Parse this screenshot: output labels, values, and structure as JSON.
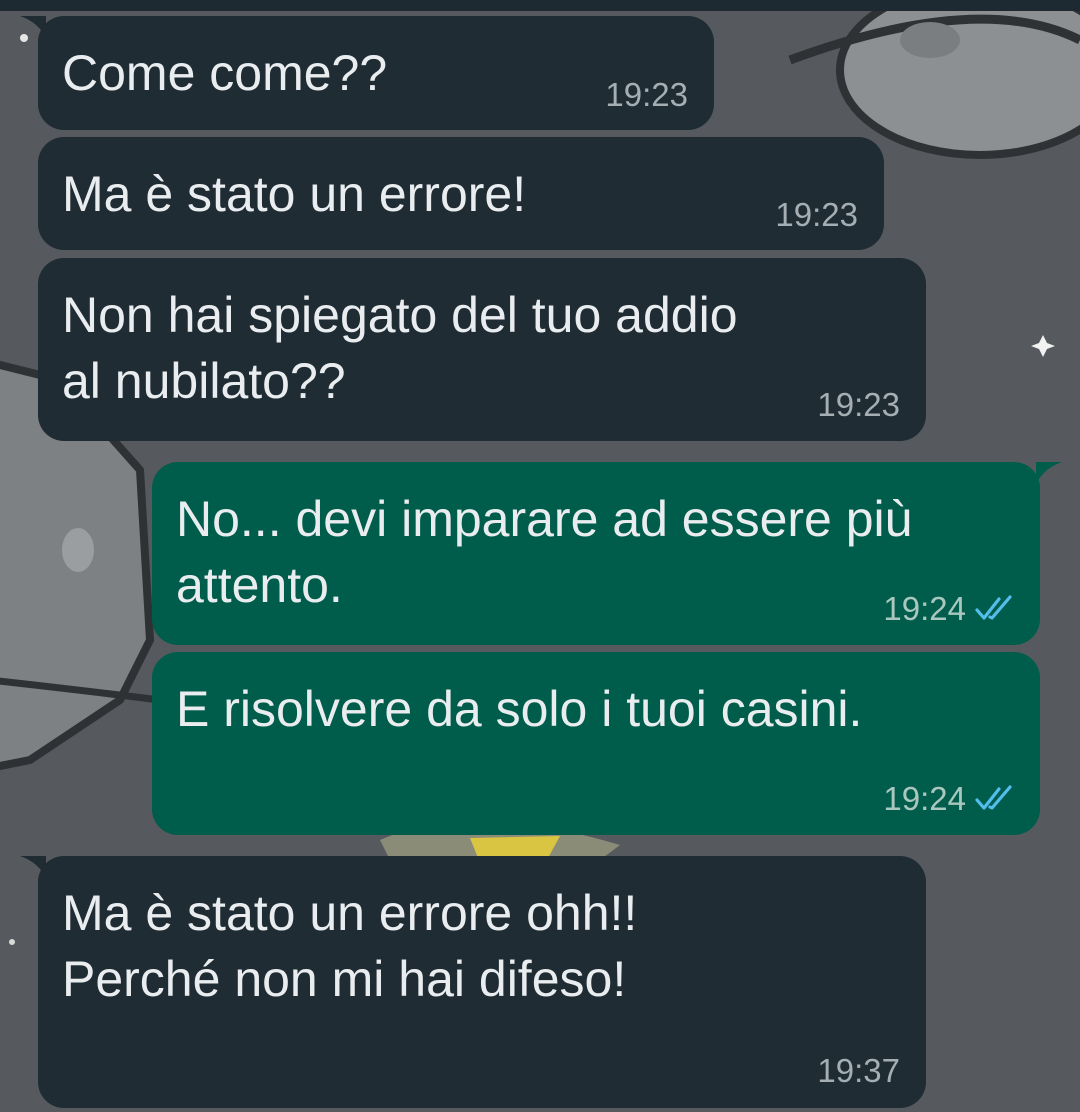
{
  "messages": [
    {
      "direction": "incoming",
      "text": "Come come??",
      "time": "19:23"
    },
    {
      "direction": "incoming",
      "text": "Ma è stato un errore!",
      "time": "19:23"
    },
    {
      "direction": "incoming",
      "text": "Non hai spiegato del tuo addio\nal nubilato??",
      "time": "19:23"
    },
    {
      "direction": "outgoing",
      "text": "No... devi imparare ad essere più\nattento.",
      "time": "19:24",
      "status": "read"
    },
    {
      "direction": "outgoing",
      "text": "E risolvere da solo i tuoi casini.",
      "time": "19:24",
      "status": "read"
    },
    {
      "direction": "incoming",
      "text": "Ma è stato un errore ohh!!\nPerché non mi hai difeso!",
      "time": "19:37"
    }
  ],
  "icons": {
    "read_receipt": "double-check-icon"
  },
  "colors": {
    "background": "#56595d",
    "incoming_bubble": "#1f2c34",
    "outgoing_bubble": "#005c4b",
    "message_text": "#e9edef",
    "read_tick": "#53bdeb"
  }
}
